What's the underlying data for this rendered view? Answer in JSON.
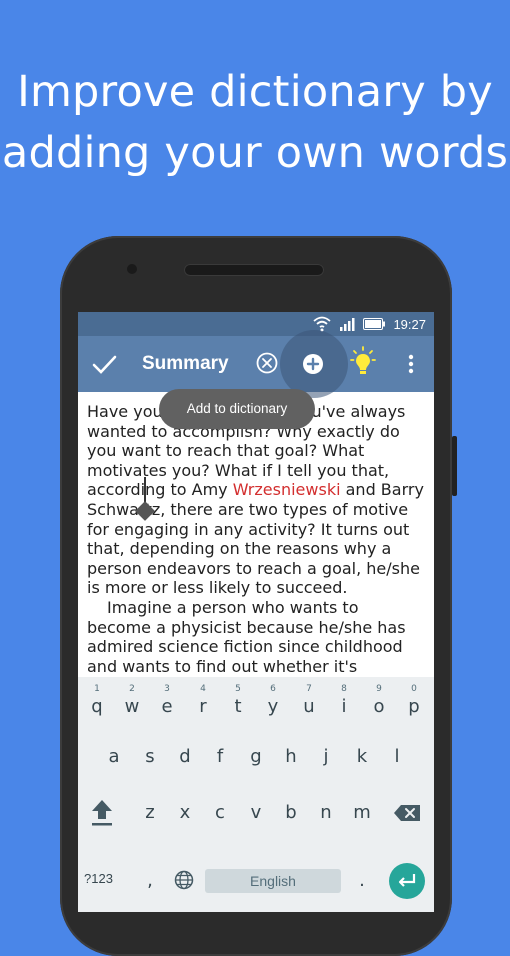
{
  "headline": {
    "line1": "Improve dictionary by",
    "line2": "adding your own words"
  },
  "status_bar": {
    "time": "19:27",
    "icons": [
      "wifi-icon",
      "signal-icon",
      "battery-icon"
    ]
  },
  "toolbar": {
    "title": "Summary",
    "icons": [
      "check-icon",
      "clear-icon",
      "add-icon",
      "lightbulb-icon",
      "more-vert-icon"
    ]
  },
  "tooltip": {
    "label": "Add to dictionary"
  },
  "document": {
    "p1_before": "Have you ever set a goal you've always wanted to accomplish? Why exactly do you want to reach that goal? What motivates you? What if I tell you that, according to Amy ",
    "p1_error_word": "Wrzesniewski",
    "p1_after": " and Barry Schwartz, there are two types of motive for engaging in any activity? It turns out that, depending on the reasons why a person endeavors to reach a goal, he/she is more or less likely to succeed.",
    "p2": "Imagine a person who wants to become a physicist because he/she has admired science fiction since childhood and wants to find out whether it's possible to travel"
  },
  "keyboard": {
    "row1": [
      {
        "key": "q",
        "num": "1"
      },
      {
        "key": "w",
        "num": "2"
      },
      {
        "key": "e",
        "num": "3"
      },
      {
        "key": "r",
        "num": "4"
      },
      {
        "key": "t",
        "num": "5"
      },
      {
        "key": "y",
        "num": "6"
      },
      {
        "key": "u",
        "num": "7"
      },
      {
        "key": "i",
        "num": "8"
      },
      {
        "key": "o",
        "num": "9"
      },
      {
        "key": "p",
        "num": "0"
      }
    ],
    "row2": [
      "a",
      "s",
      "d",
      "f",
      "g",
      "h",
      "j",
      "k",
      "l"
    ],
    "row3": [
      "z",
      "x",
      "c",
      "v",
      "b",
      "n",
      "m"
    ],
    "symbols_label": "?123",
    "comma": ",",
    "period": ".",
    "space_label": "English",
    "icons": [
      "shift-icon",
      "backspace-icon",
      "globe-icon",
      "enter-icon"
    ]
  },
  "colors": {
    "background": "#4a86e8",
    "toolbar": "#5b80ac",
    "statusbar": "#4a6c93",
    "error": "#d32f2f",
    "enter_key": "#26a69a"
  }
}
